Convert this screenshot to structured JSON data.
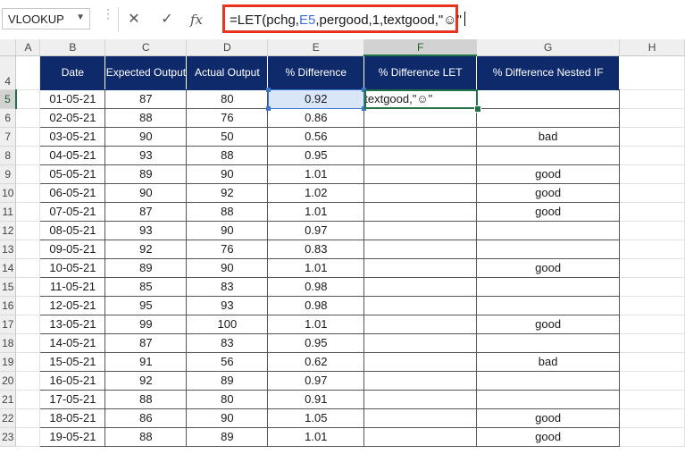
{
  "formula_bar": {
    "name_box": "VLOOKUP",
    "cancel_icon": "✕",
    "enter_icon": "✓",
    "insert_function_label": "fx",
    "formula_prefix": "=LET(pchg,",
    "formula_ref": "E5",
    "formula_suffix": ",pergood,1,textgood,\"☺\""
  },
  "columns": [
    "A",
    "B",
    "C",
    "D",
    "E",
    "F",
    "G",
    "H"
  ],
  "selected_column": "F",
  "selected_row": "5",
  "headers": {
    "row_number": "4",
    "date": "Date",
    "expected": "Expected Output",
    "actual": "Actual Output",
    "pct_diff": "% Difference",
    "pct_diff_let": "% Difference LET",
    "pct_diff_nested_if": "% Difference Nested IF"
  },
  "editing_cell_text": "textgood,\"☺\"",
  "rows": [
    {
      "row": "5",
      "date": "01-05-21",
      "expected": "87",
      "actual": "80",
      "pct": "0.92",
      "let": "",
      "nested": ""
    },
    {
      "row": "6",
      "date": "02-05-21",
      "expected": "88",
      "actual": "76",
      "pct": "0.86",
      "let": "",
      "nested": ""
    },
    {
      "row": "7",
      "date": "03-05-21",
      "expected": "90",
      "actual": "50",
      "pct": "0.56",
      "let": "",
      "nested": "bad"
    },
    {
      "row": "8",
      "date": "04-05-21",
      "expected": "93",
      "actual": "88",
      "pct": "0.95",
      "let": "",
      "nested": ""
    },
    {
      "row": "9",
      "date": "05-05-21",
      "expected": "89",
      "actual": "90",
      "pct": "1.01",
      "let": "",
      "nested": "good"
    },
    {
      "row": "10",
      "date": "06-05-21",
      "expected": "90",
      "actual": "92",
      "pct": "1.02",
      "let": "",
      "nested": "good"
    },
    {
      "row": "11",
      "date": "07-05-21",
      "expected": "87",
      "actual": "88",
      "pct": "1.01",
      "let": "",
      "nested": "good"
    },
    {
      "row": "12",
      "date": "08-05-21",
      "expected": "93",
      "actual": "90",
      "pct": "0.97",
      "let": "",
      "nested": ""
    },
    {
      "row": "13",
      "date": "09-05-21",
      "expected": "92",
      "actual": "76",
      "pct": "0.83",
      "let": "",
      "nested": ""
    },
    {
      "row": "14",
      "date": "10-05-21",
      "expected": "89",
      "actual": "90",
      "pct": "1.01",
      "let": "",
      "nested": "good"
    },
    {
      "row": "15",
      "date": "11-05-21",
      "expected": "85",
      "actual": "83",
      "pct": "0.98",
      "let": "",
      "nested": ""
    },
    {
      "row": "16",
      "date": "12-05-21",
      "expected": "95",
      "actual": "93",
      "pct": "0.98",
      "let": "",
      "nested": ""
    },
    {
      "row": "17",
      "date": "13-05-21",
      "expected": "99",
      "actual": "100",
      "pct": "1.01",
      "let": "",
      "nested": "good"
    },
    {
      "row": "18",
      "date": "14-05-21",
      "expected": "87",
      "actual": "83",
      "pct": "0.95",
      "let": "",
      "nested": ""
    },
    {
      "row": "19",
      "date": "15-05-21",
      "expected": "91",
      "actual": "56",
      "pct": "0.62",
      "let": "",
      "nested": "bad"
    },
    {
      "row": "20",
      "date": "16-05-21",
      "expected": "92",
      "actual": "89",
      "pct": "0.97",
      "let": "",
      "nested": ""
    },
    {
      "row": "21",
      "date": "17-05-21",
      "expected": "88",
      "actual": "80",
      "pct": "0.91",
      "let": "",
      "nested": ""
    },
    {
      "row": "22",
      "date": "18-05-21",
      "expected": "86",
      "actual": "90",
      "pct": "1.05",
      "let": "",
      "nested": "good"
    },
    {
      "row": "23",
      "date": "19-05-21",
      "expected": "88",
      "actual": "89",
      "pct": "1.01",
      "let": "",
      "nested": "good"
    }
  ],
  "colors": {
    "header_fill": "#0f2a6b",
    "formula_highlight": "#e8341c",
    "selection_green": "#217346",
    "reference_blue": "#3b78c9"
  }
}
